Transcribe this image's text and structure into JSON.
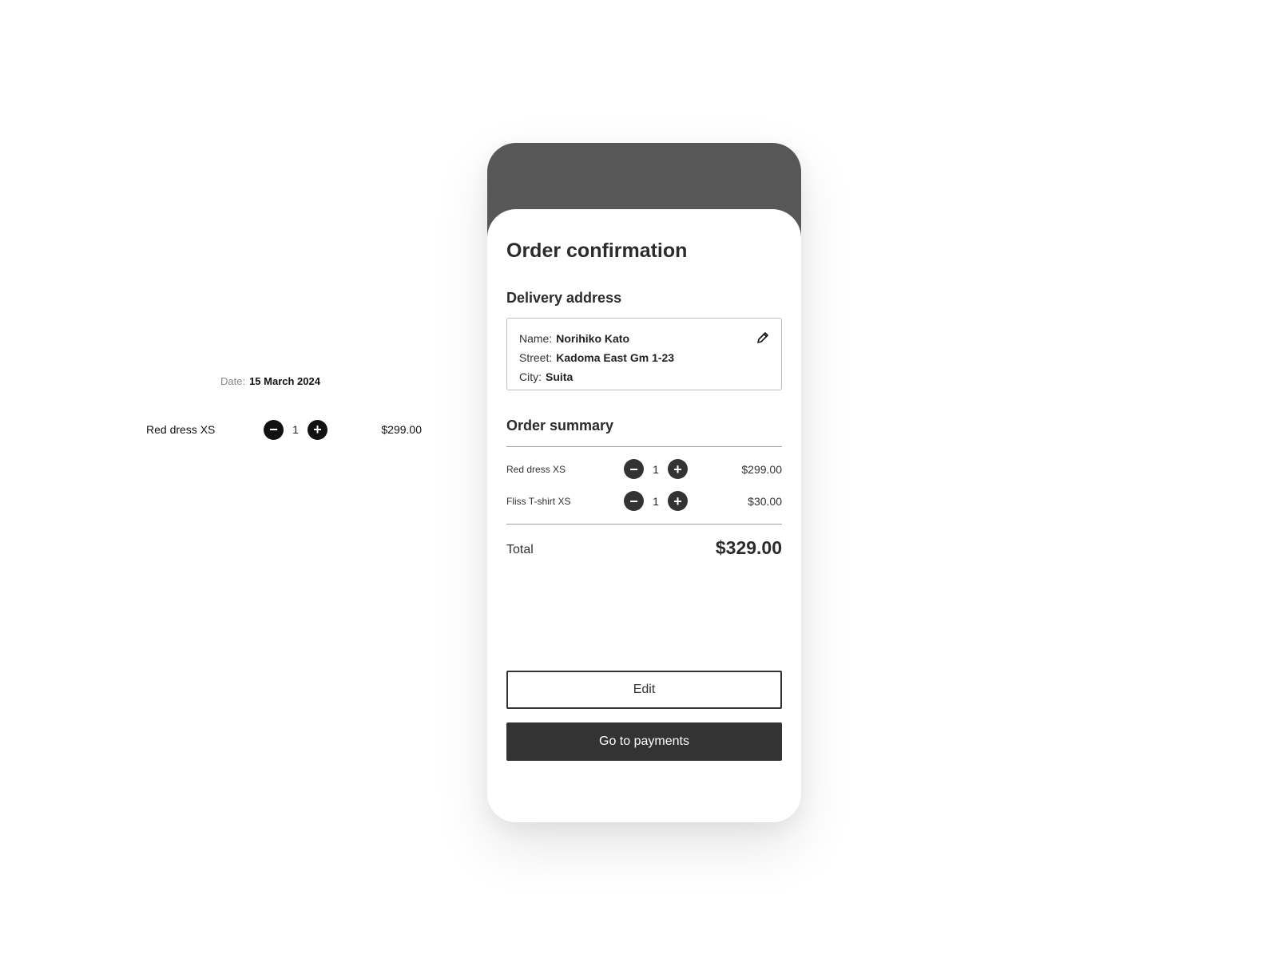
{
  "loose": {
    "date_label": "Date:",
    "date_value": "15 March 2024",
    "item": {
      "name": "Red dress XS",
      "qty": "1",
      "price": "$299.00",
      "minus": "−",
      "plus": "+"
    }
  },
  "screen": {
    "title": "Order confirmation",
    "delivery_title": "Delivery address",
    "address": {
      "name_label": "Name:",
      "name_value": "Norihiko Kato",
      "street_label": "Street:",
      "street_value": "Kadoma East Gm 1-23",
      "city_label": "City:",
      "city_value": "Suita",
      "edit_icon": "pencil-icon"
    },
    "summary_title": "Order summary",
    "items": [
      {
        "name": "Red dress XS",
        "qty": "1",
        "price": "$299.00",
        "minus": "−",
        "plus": "+"
      },
      {
        "name": "Fliss T-shirt XS",
        "qty": "1",
        "price": "$30.00",
        "minus": "−",
        "plus": "+"
      }
    ],
    "total_label": "Total",
    "total_value": "$329.00",
    "edit_button": "Edit",
    "pay_button": "Go to payments"
  },
  "colors": {
    "header": "#575757",
    "primary_button": "#333333",
    "stepper_loose": "#111111"
  }
}
